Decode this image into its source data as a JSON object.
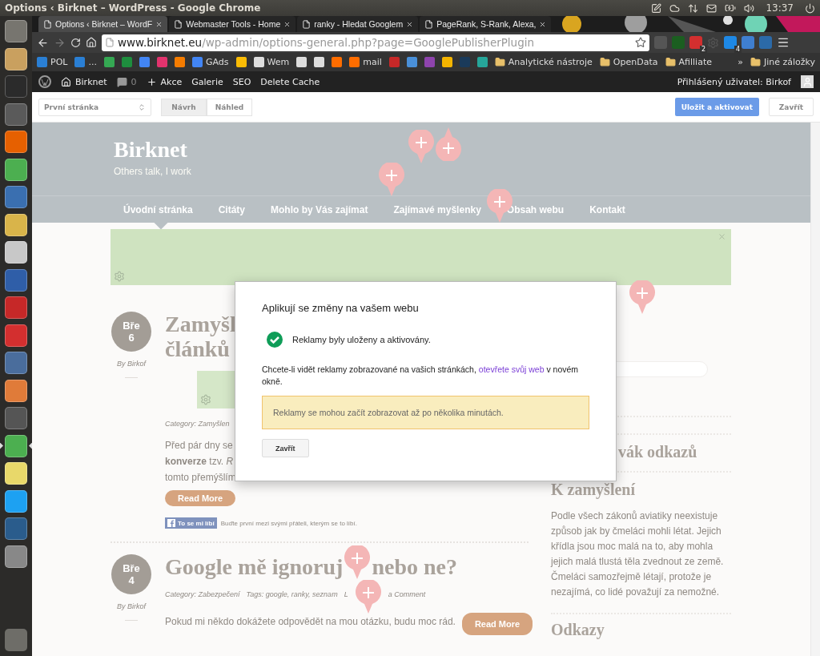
{
  "system_bar": {
    "title": "Options ‹ Birknet – WordPress - Google Chrome",
    "clock": "13:37"
  },
  "launcher": [
    {
      "focused": false
    },
    {
      "focused": false
    },
    {
      "focused": false
    },
    {
      "focused": false
    },
    {
      "focused": false
    },
    {
      "focused": false
    },
    {
      "focused": false
    },
    {
      "focused": false
    },
    {
      "focused": false
    },
    {
      "focused": false
    },
    {
      "focused": false
    },
    {
      "focused": false
    },
    {
      "focused": false
    },
    {
      "focused": false
    },
    {
      "focused": false
    },
    {
      "focused": true
    },
    {
      "focused": false
    },
    {
      "focused": false
    },
    {
      "focused": false
    },
    {
      "focused": false
    }
  ],
  "tabs": [
    {
      "label": "Options ‹ Birknet – WordF",
      "selected": true
    },
    {
      "label": "Webmaster Tools - Home",
      "selected": false
    },
    {
      "label": "ranky - Hledat Googlem",
      "selected": false
    },
    {
      "label": "PageRank, S-Rank, Alexa,",
      "selected": false
    }
  ],
  "address": {
    "host": "www.birknet.eu",
    "path": "/wp-admin/options-general.php?page=GooglePublisherPlugin"
  },
  "extension_badges": [
    "2",
    "4"
  ],
  "bookmarks": [
    {
      "kind": "link",
      "label": "POL"
    },
    {
      "kind": "link",
      "label": "..."
    },
    {
      "kind": "icon"
    },
    {
      "kind": "icon"
    },
    {
      "kind": "icon"
    },
    {
      "kind": "icon"
    },
    {
      "kind": "icon"
    },
    {
      "kind": "link",
      "label": "GAds"
    },
    {
      "kind": "icon"
    },
    {
      "kind": "link",
      "label": "Wem"
    },
    {
      "kind": "icon"
    },
    {
      "kind": "icon"
    },
    {
      "kind": "icon"
    },
    {
      "kind": "link",
      "label": "mail"
    },
    {
      "kind": "icon"
    },
    {
      "kind": "icon"
    },
    {
      "kind": "icon"
    },
    {
      "kind": "icon"
    },
    {
      "kind": "icon"
    },
    {
      "kind": "icon"
    },
    {
      "kind": "folder",
      "label": "Analytické nástroje"
    },
    {
      "kind": "folder",
      "label": "OpenData"
    },
    {
      "kind": "folder",
      "label": "Afilliate"
    }
  ],
  "bookmarks_overflow": "»",
  "other_bookmarks": "Jiné záložky",
  "admin_bar": {
    "site": "Birknet",
    "comments": "0",
    "new": "Akce",
    "links": [
      "Galerie",
      "SEO",
      "Delete Cache"
    ],
    "user": "Přihlášený uživatel: Birkof"
  },
  "customizer": {
    "page_select": "První stránka",
    "modes": [
      {
        "label": "Návrh",
        "selected": true
      },
      {
        "label": "Náhled",
        "selected": false
      }
    ],
    "save": "Uložit a aktivovat",
    "close": "Zavřít"
  },
  "site": {
    "title": "Birknet",
    "tagline": "Others talk, I work",
    "nav": [
      {
        "label": "Úvodní stránka",
        "selected": true
      },
      {
        "label": "Citáty",
        "selected": false
      },
      {
        "label": "Mohlo by Vás zajímat",
        "selected": false
      },
      {
        "label": "Zajímavé myšlenky",
        "selected": false
      },
      {
        "label": "Obsah webu",
        "selected": false
      },
      {
        "label": "Kontakt",
        "selected": false
      }
    ],
    "posts": [
      {
        "month": "Bře",
        "day": "6",
        "author": "By Birkof",
        "title_lines": [
          "Zamyšl",
          "článků"
        ],
        "has_ad": true,
        "meta": [
          "Category: Zamyšlen"
        ],
        "excerpt": [
          "Před pár dny se",
          "**konverze** tzv. *R*",
          "tomto přemýšlím"
        ],
        "read_more": "Read More",
        "like": "To se mi líbí",
        "like_text": "Buďte první mezi svými přáteli, kterým se to líbí."
      },
      {
        "month": "Bře",
        "day": "4",
        "author": "By Birkof",
        "title_parts": [
          "Google mě ignoruj",
          "nebo ne?"
        ],
        "has_ad": false,
        "meta": [
          "Category: Zabezpečení",
          "Tags: google, ranky, seznam"
        ],
        "meta_tail": [
          "L",
          "a Comment"
        ],
        "excerpt": [
          "Pokud mi někdo dokážete odpovědět na mou otázku, budu moc rád."
        ],
        "read_more": "Read More"
      }
    ],
    "sidebar": {
      "headings": [
        "vák odkazů",
        "K zamyšlení"
      ],
      "quote": "Podle všech zákonů aviatiky neexistuje způsob jak by čmeláci mohli létat. Jejich křídla jsou moc malá na to, aby mohla jejich malá tlustá těla zvednout ze země. Čmeláci samozřejmě létají, protože je nezajímá, co lidé považují za nemožné.",
      "last_heading": "Odkazy"
    }
  },
  "modal": {
    "title": "Aplikují se změny na vašem webu",
    "success": "Reklamy byly uloženy a aktivovány.",
    "info_before": "Chcete-li vidět reklamy zobrazované na vašich stránkách, ",
    "info_link": "otevřete svůj web",
    "info_after": " v novém okně.",
    "warning": "Reklamy se mohou začít zobrazovat až po několika minutách.",
    "button": "Zavřít"
  }
}
